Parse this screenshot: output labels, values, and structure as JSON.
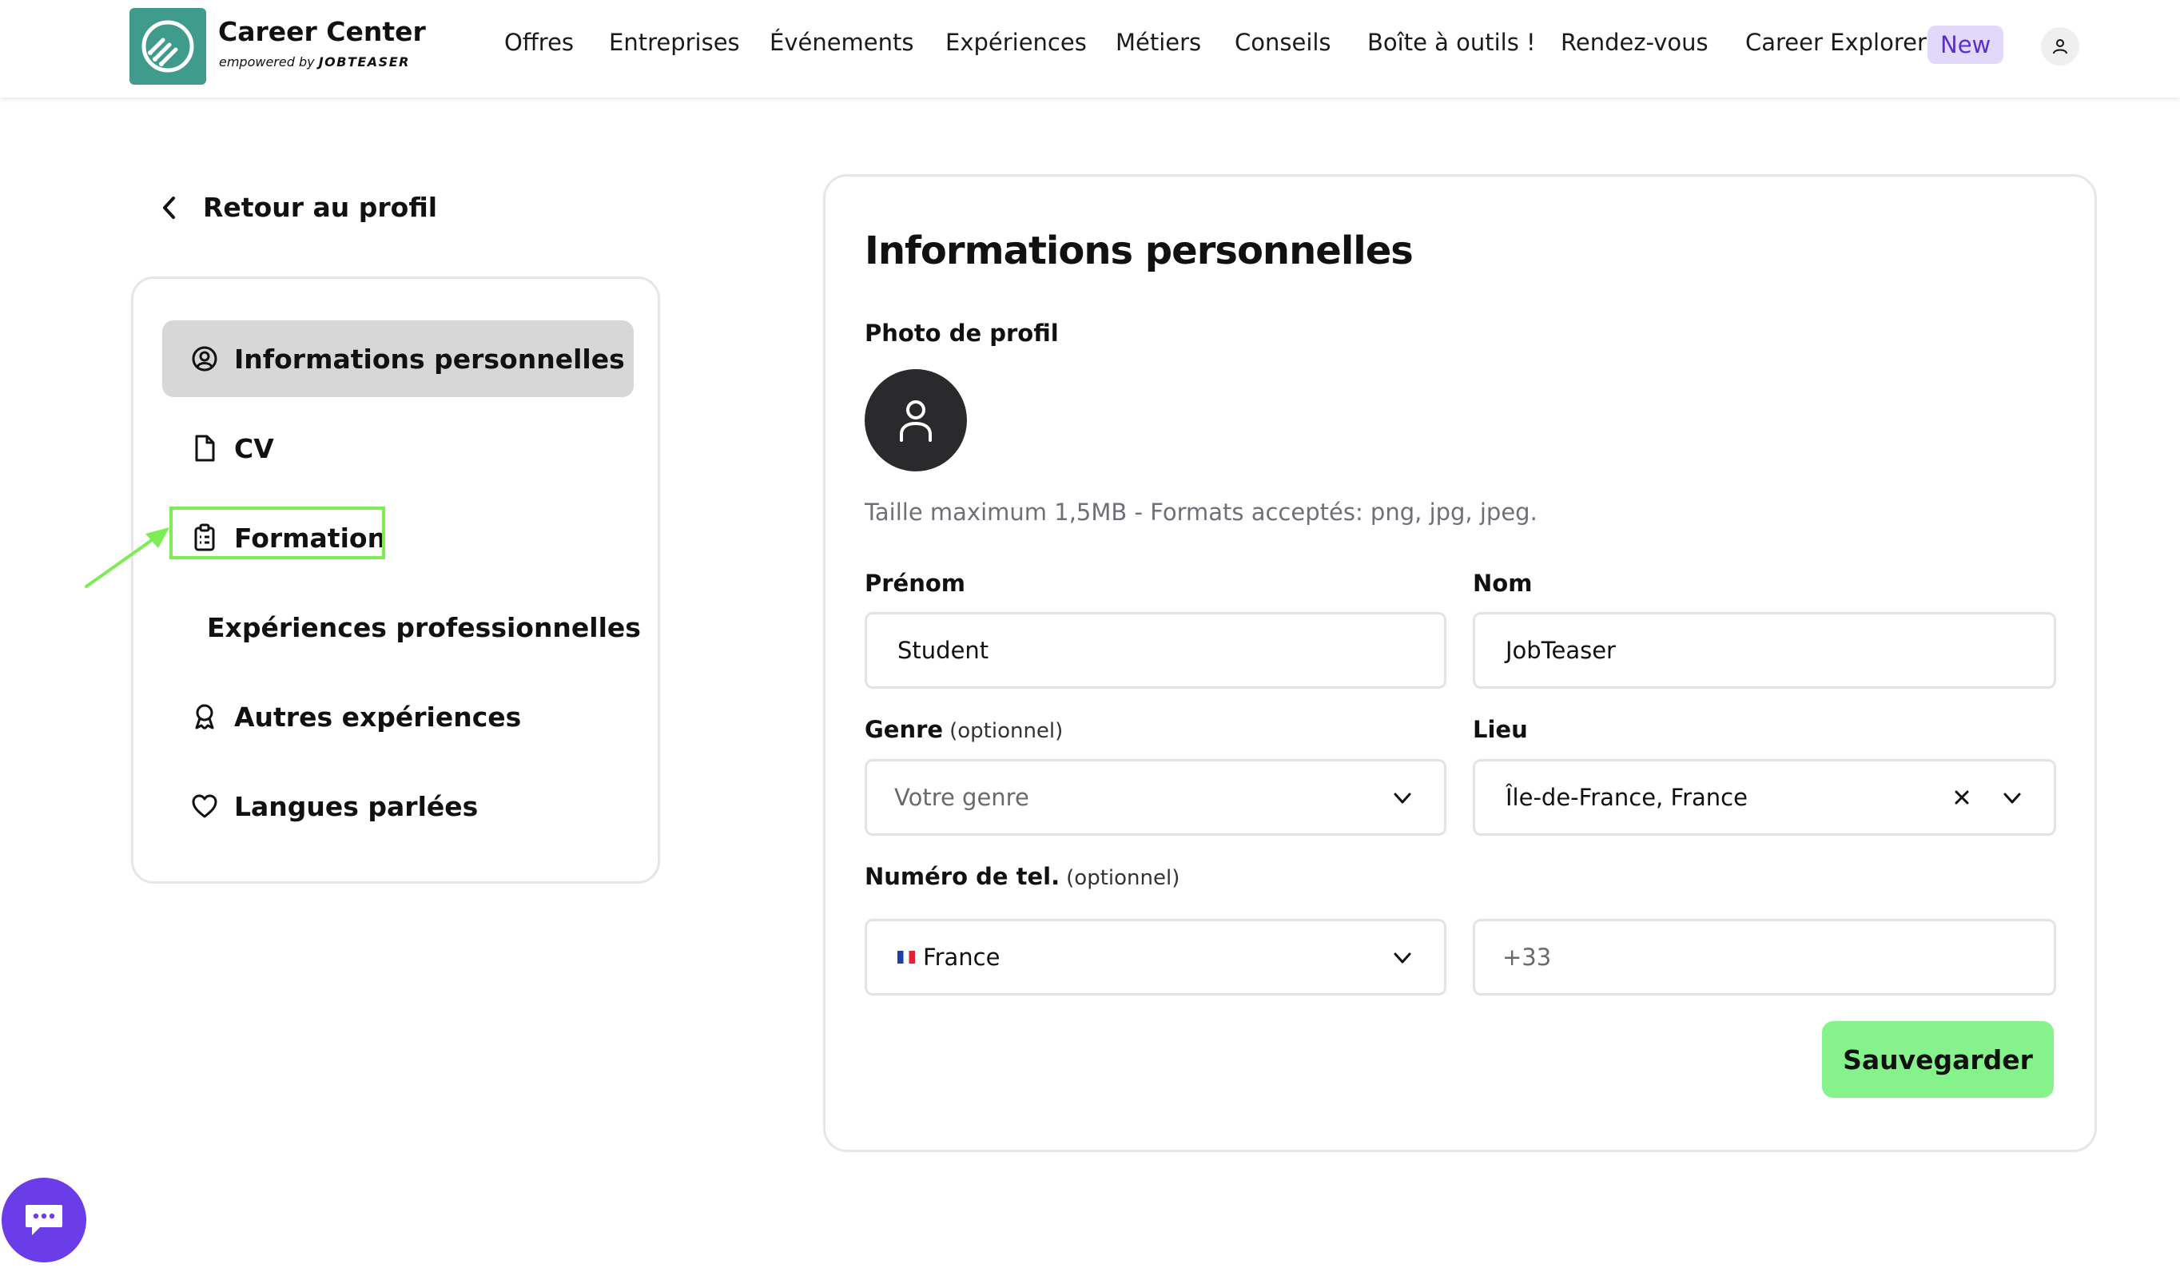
{
  "header": {
    "brand_title": "Career Center",
    "brand_sub_prefix": "empowered by",
    "brand_sub_name": "JOBTEASER",
    "nav": [
      "Offres",
      "Entreprises",
      "Événements",
      "Expériences",
      "Métiers",
      "Conseils",
      "Boîte à outils !",
      "Rendez-vous",
      "Career Explorer"
    ],
    "new_badge": "New",
    "user_icon": "user-icon"
  },
  "back_link": "Retour au profil",
  "sidebar": {
    "items": [
      {
        "label": "Informations personnelles",
        "icon": "user-circle-icon",
        "active": true
      },
      {
        "label": "CV",
        "icon": "document-icon",
        "active": false
      },
      {
        "label": "Formation",
        "icon": "clipboard-icon",
        "active": false
      },
      {
        "label": "Expériences professionnelles",
        "icon": "briefcase-icon",
        "active": false
      },
      {
        "label": "Autres expériences",
        "icon": "award-icon",
        "active": false
      },
      {
        "label": "Langues parlées",
        "icon": "heart-icon",
        "active": false
      }
    ]
  },
  "form": {
    "title": "Informations personnelles",
    "photo_label": "Photo de profil",
    "photo_hint": "Taille maximum 1,5MB - Formats acceptés: png, jpg, jpeg.",
    "first_name_label": "Prénom",
    "first_name_value": "Student",
    "last_name_label": "Nom",
    "last_name_value": "JobTeaser",
    "gender_label": "Genre",
    "optional": "(optionnel)",
    "gender_placeholder": "Votre genre",
    "location_label": "Lieu",
    "location_value": "Île-de-France, France",
    "phone_label": "Numéro de tel.",
    "country_value": "France",
    "phone_placeholder": "+33",
    "save_label": "Sauvegarder"
  },
  "colors": {
    "brand_teal": "#3f9b8b",
    "save_green": "#86f28c",
    "highlight_green": "#7ded56",
    "new_badge_bg": "#e2d8fa",
    "new_badge_text": "#5a2fc9",
    "chat_purple": "#6a3de8"
  }
}
